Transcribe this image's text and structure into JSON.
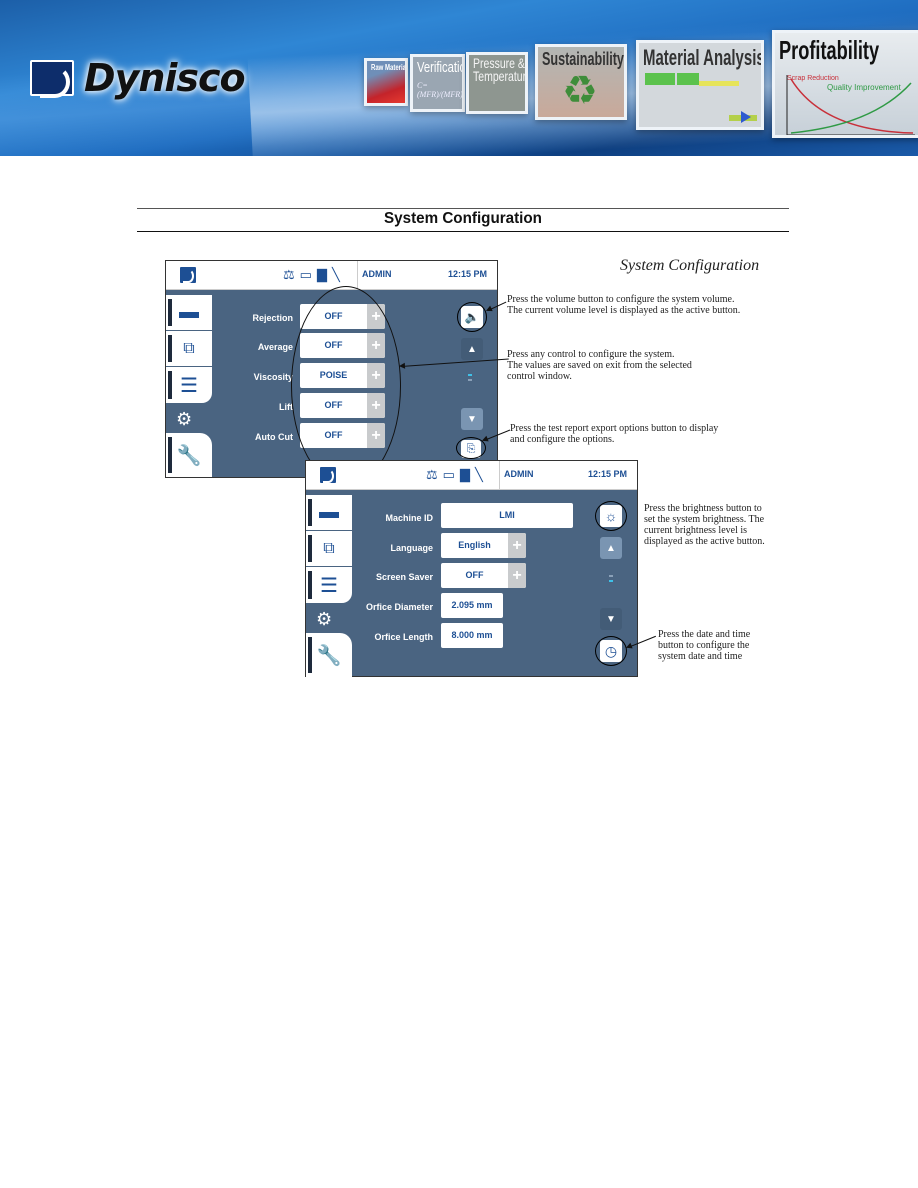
{
  "banner": {
    "brand": "Dynisco",
    "tiles": [
      {
        "title": "Raw Materials"
      },
      {
        "title": "Verification",
        "subtitle": "C= (MFR)/(MFR)"
      },
      {
        "title": "Pressure & Temperature"
      },
      {
        "title": "Sustainability"
      },
      {
        "title": "Material Analysis"
      },
      {
        "title": "Profitability",
        "lines": [
          "Scrap Reduction",
          "Quality Improvement"
        ]
      }
    ]
  },
  "section": {
    "title": "System Configuration",
    "figure_title": "System Configuration"
  },
  "screen1": {
    "user": "ADMIN",
    "time": "12:15 PM",
    "status_icons": [
      "balance-icon",
      "laptop-icon",
      "printer-icon",
      "usb-icon"
    ],
    "rows": [
      {
        "label": "Rejection",
        "value": "OFF"
      },
      {
        "label": "Average",
        "value": "OFF"
      },
      {
        "label": "Viscosity",
        "value": "POISE"
      },
      {
        "label": "Lift",
        "value": "OFF"
      },
      {
        "label": "Auto Cut",
        "value": "OFF"
      }
    ],
    "plus": "+"
  },
  "screen2": {
    "user": "ADMIN",
    "time": "12:15 PM",
    "rows": [
      {
        "label": "Machine ID",
        "value": "LMI"
      },
      {
        "label": "Language",
        "value": "English"
      },
      {
        "label": "Screen Saver",
        "value": "OFF"
      },
      {
        "label": "Orfice Diameter",
        "value": "2.095 mm"
      },
      {
        "label": "Orfice Length",
        "value": "8.000 mm"
      }
    ],
    "plus": "+"
  },
  "callouts": {
    "volume": [
      "Press the volume button to configure the system volume.",
      "The current volume level is displayed as the active button."
    ],
    "controls": [
      "Press any control to configure the system.",
      "The values are saved on exit from the selected",
      "control window."
    ],
    "export": [
      "Press the test report export options button to display",
      "and configure the options."
    ],
    "brightness": [
      "Press the brightness button to",
      "set the system brightness. The",
      "current brightness level is",
      "displayed as the active button."
    ],
    "datetime": [
      "Press the date and time",
      "button to configure the",
      "system date and time"
    ]
  }
}
